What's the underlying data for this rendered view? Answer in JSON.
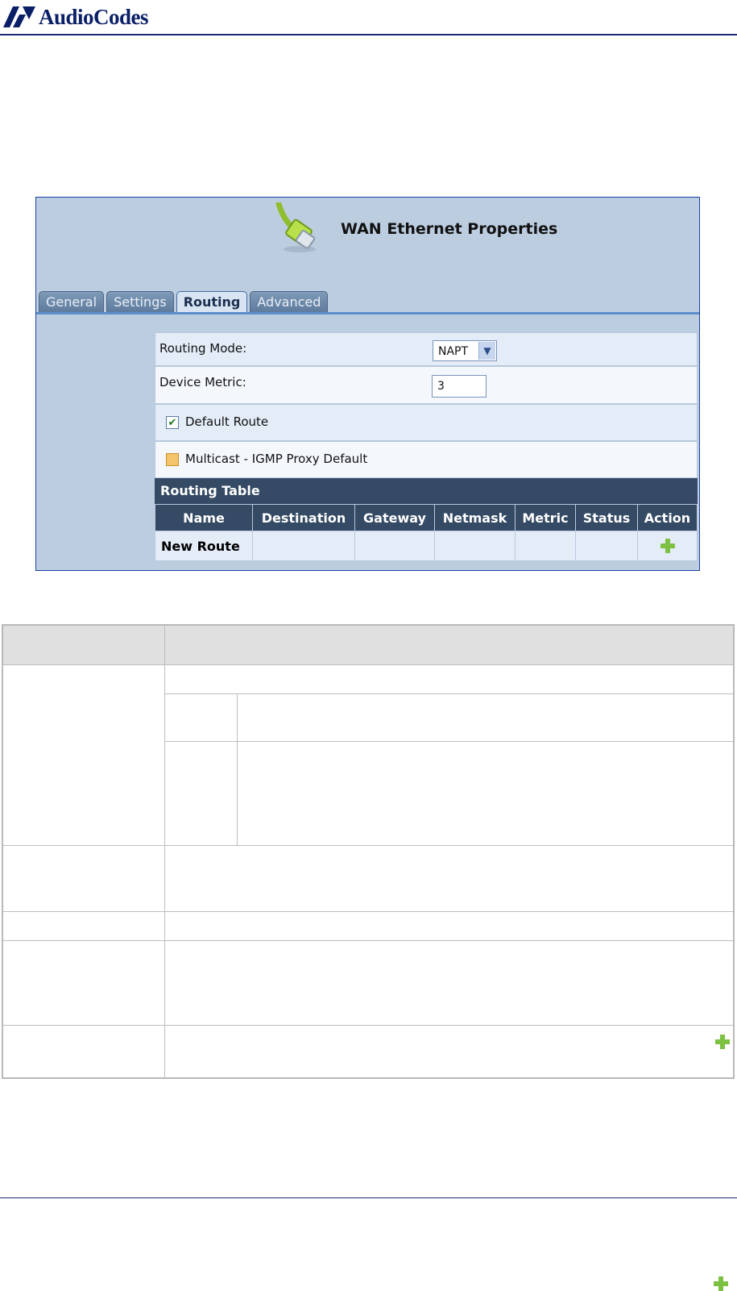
{
  "header": {
    "brand": "AudioCodes"
  },
  "screen": {
    "title": "WAN Ethernet Properties",
    "tabs": [
      "General",
      "Settings",
      "Routing",
      "Advanced"
    ],
    "active_tab": "Routing",
    "routing_mode": {
      "label": "Routing Mode:",
      "value": "NAPT"
    },
    "device_metric": {
      "label": "Device Metric:",
      "value": "3"
    },
    "default_route": {
      "label": "Default Route",
      "checked": true
    },
    "multicast": {
      "label": "Multicast - IGMP Proxy Default",
      "checked": false
    },
    "routing_table": {
      "title": "Routing Table",
      "columns": [
        "Name",
        "Destination",
        "Gateway",
        "Netmask",
        "Metric",
        "Status",
        "Action"
      ],
      "rows": [
        {
          "name": "New Route",
          "action_icon": "add-icon"
        }
      ]
    }
  },
  "colors": {
    "brand": "#0a1f66",
    "tab_line": "#5b8ec9",
    "table_header": "#354a64",
    "add_icon": "#7cc142"
  }
}
